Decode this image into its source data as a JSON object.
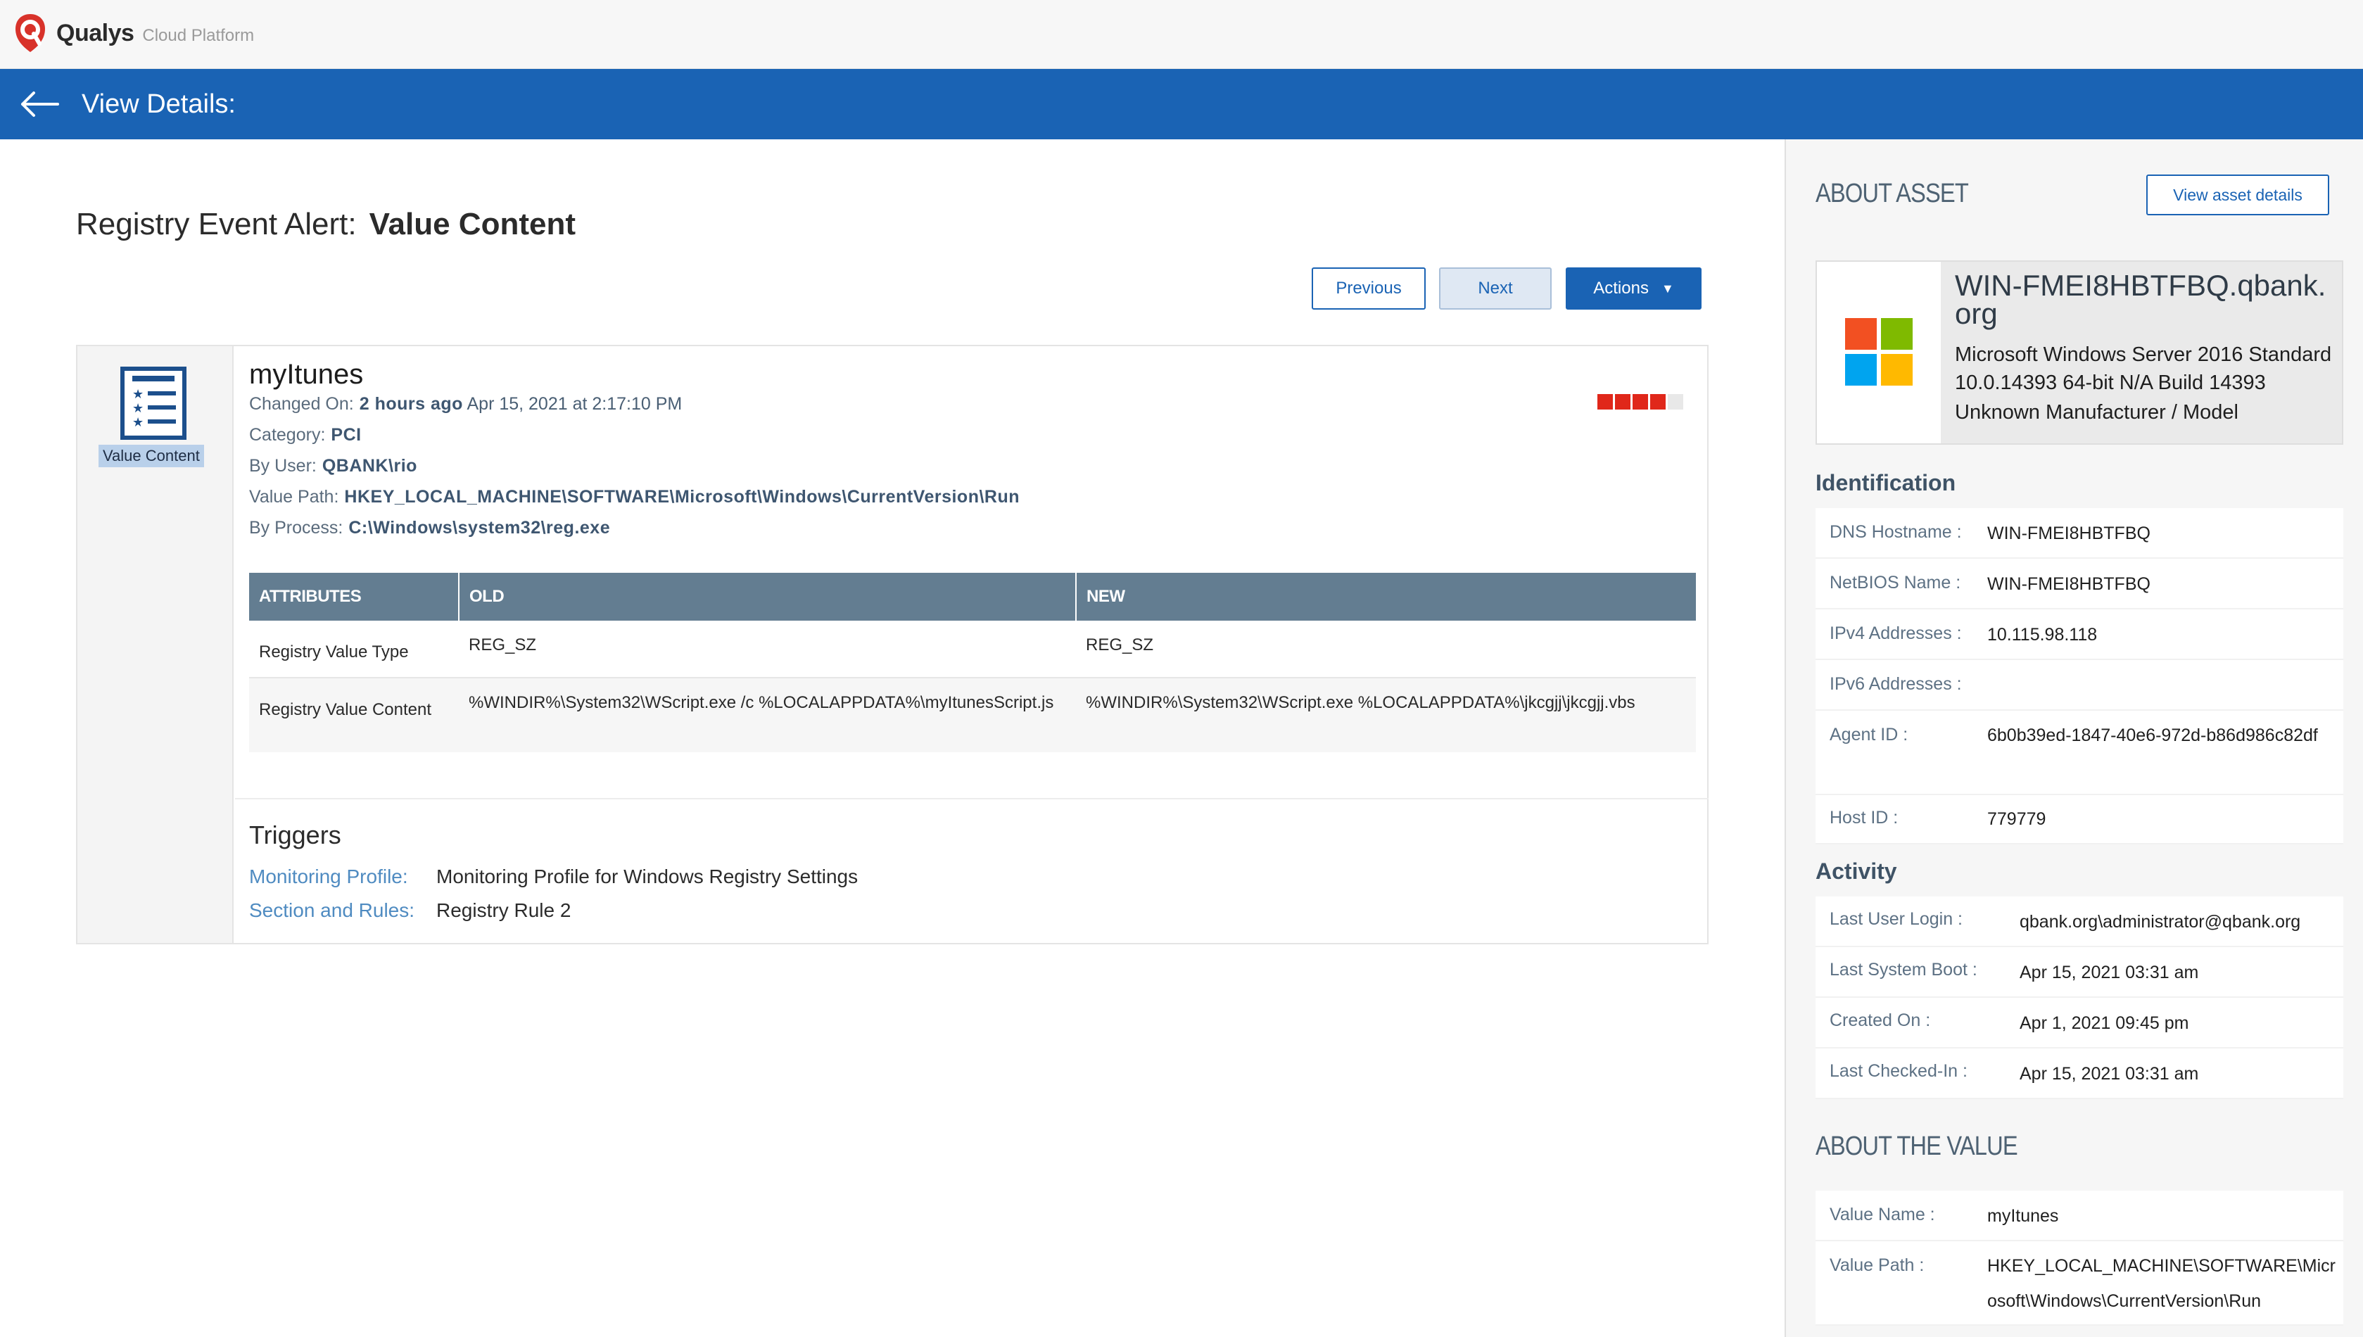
{
  "brand": {
    "name": "Qualys",
    "product": "Cloud Platform",
    "brand_color": "#d8322a"
  },
  "header": {
    "title": "View Details:",
    "back_icon": "arrow-left-icon",
    "bg_color": "#1a63b4"
  },
  "page": {
    "title_prefix": "Registry Event Alert:",
    "title_strong": "Value Content"
  },
  "nav": {
    "previous": "Previous",
    "next": "Next",
    "actions": "Actions",
    "actions_caret": "▼"
  },
  "event": {
    "type_label": "Value Content",
    "name": "myItunes",
    "changed_on_label": "Changed On:",
    "changed_on_relative": "2 hours ago",
    "changed_on_date": "Apr 15, 2021 at 2:17:10 PM",
    "category_label": "Category:",
    "category": "PCI",
    "user_label": "By User:",
    "user": "QBANK\\rio",
    "value_path_label": "Value Path:",
    "value_path": "HKEY_LOCAL_MACHINE\\SOFTWARE\\Microsoft\\Windows\\CurrentVersion\\Run",
    "process_label": "By Process:",
    "process": "C:\\Windows\\system32\\reg.exe",
    "severity": 4,
    "severity_max": 5
  },
  "attributes": {
    "headers": [
      "Attributes",
      "Old",
      "New"
    ],
    "rows": [
      {
        "attribute": "Registry Value Type",
        "old": "REG_SZ",
        "new": "REG_SZ"
      },
      {
        "attribute": "Registry Value Content",
        "old": "%WINDIR%\\System32\\WScript.exe /c %LOCALAPPDATA%\\myItunesScript.js",
        "new": "%WINDIR%\\System32\\WScript.exe %LOCALAPPDATA%\\jkcgjj\\jkcgjj.vbs"
      }
    ]
  },
  "triggers": {
    "title": "Triggers",
    "profile_label": "Monitoring Profile:",
    "profile": "Monitoring Profile for Windows Registry Settings",
    "rules_label": "Section and Rules:",
    "rules": "Registry Rule 2"
  },
  "about_asset": {
    "title": "ABOUT ASSET",
    "view_button": "View asset details",
    "name": "WIN-FMEI8HBTFBQ.qbank.org",
    "os": "Microsoft Windows Server 2016 Standard 10.0.14393 64-bit N/A Build 14393",
    "manufacturer": "Unknown Manufacturer / Model",
    "os_icon": "windows-logo-icon"
  },
  "identification": {
    "title": "Identification",
    "rows": [
      {
        "label": "DNS Hostname",
        "value": "WIN-FMEI8HBTFBQ"
      },
      {
        "label": "NetBIOS Name",
        "value": "WIN-FMEI8HBTFBQ"
      },
      {
        "label": "IPv4 Addresses",
        "value": "10.115.98.118"
      },
      {
        "label": "IPv6 Addresses",
        "value": ""
      },
      {
        "label": "Agent ID",
        "value": "6b0b39ed-1847-40e6-972d-b86d986c82df"
      },
      {
        "label": "Host ID",
        "value": "779779"
      }
    ]
  },
  "activity": {
    "title": "Activity",
    "rows": [
      {
        "label": "Last User Login",
        "value": "qbank.org\\administrator@qbank.org"
      },
      {
        "label": "Last System Boot",
        "value": "Apr 15, 2021 03:31 am"
      },
      {
        "label": "Created On",
        "value": "Apr 1, 2021 09:45 pm"
      },
      {
        "label": "Last Checked-In",
        "value": "Apr 15, 2021 03:31 am"
      }
    ]
  },
  "about_value": {
    "title": "ABOUT THE VALUE",
    "rows": [
      {
        "label": "Value Name",
        "value": "myItunes"
      },
      {
        "label": "Value Path",
        "value": "HKEY_LOCAL_MACHINE\\SOFTWARE\\Microsoft\\Windows\\CurrentVersion\\Run"
      }
    ]
  },
  "colors": {
    "accent": "#1a63b4",
    "severity_on": "#e0271a",
    "severity_off": "#e8e8e8",
    "table_header": "#637d91"
  }
}
